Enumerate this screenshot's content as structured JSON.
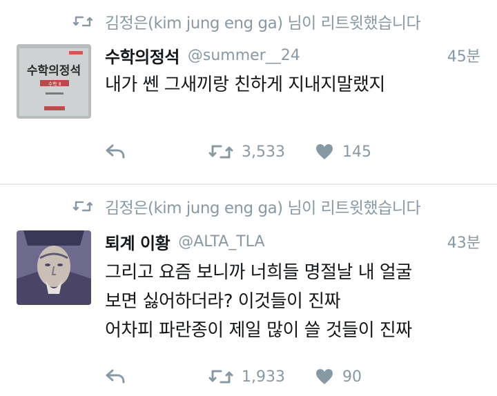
{
  "tweets": [
    {
      "retweet_notice": "김정은(kim jung eng ga) 님이 리트윗했습니다",
      "avatar_text": {
        "brand": "수학의정석",
        "subtitle": "수학 Ⅱ"
      },
      "display_name": "수학의정석",
      "handle": "@summer__24",
      "timestamp": "45분",
      "text_lines": [
        "내가 쎈 그새끼랑 친하게 지내지말랬지"
      ],
      "retweet_count": "3,533",
      "like_count": "145"
    },
    {
      "retweet_notice": "김정은(kim jung eng ga) 님이 리트윗했습니다",
      "display_name": "퇴계 이황",
      "handle": "@ALTA_TLA",
      "timestamp": "43분",
      "text_lines": [
        "그리고 요즘 보니까 너희들 명절날 내 얼굴",
        "보면 싫어하더라? 이것들이 진짜",
        "어차피 파란종이 제일 많이 쓸 것들이 진짜"
      ],
      "retweet_count": "1,933",
      "like_count": "90"
    }
  ],
  "colors": {
    "text": "#14171a",
    "muted": "#8899a6",
    "divider": "#e6ecf0",
    "avatar_book": "#b9bcbd",
    "avatar_portrait": "#6e6a8e"
  },
  "icons": {
    "retweet_notice": "retweet-icon",
    "reply": "reply-icon",
    "retweet": "retweet-icon",
    "like": "heart-icon"
  }
}
